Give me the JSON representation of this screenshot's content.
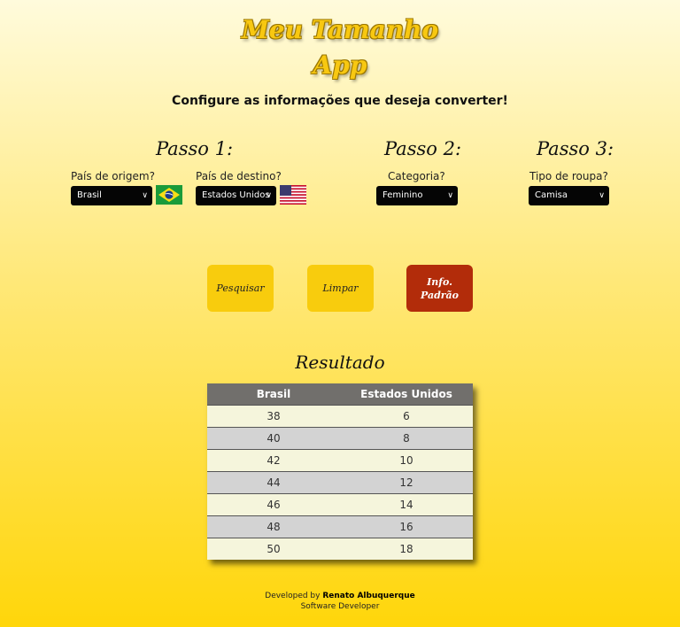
{
  "app": {
    "title_line1": "Meu Tamanho",
    "title_line2": "App",
    "subtitle": "Configure as informações que deseja converter!"
  },
  "steps": {
    "step1": "Passo 1:",
    "step2": "Passo 2:",
    "step3": "Passo 3:"
  },
  "fields": {
    "origin_label": "País de origem?",
    "origin_value": "Brasil",
    "dest_label": "País de destino?",
    "dest_value": "Estados Unidos",
    "category_label": "Categoria?",
    "category_value": "Feminino",
    "clothing_label": "Tipo de roupa?",
    "clothing_value": "Camisa"
  },
  "buttons": {
    "search": "Pesquisar",
    "clear": "Limpar",
    "info": "Info. Padrão"
  },
  "result": {
    "title": "Resultado",
    "headers": [
      "Brasil",
      "Estados Unidos"
    ],
    "rows": [
      [
        "38",
        "6"
      ],
      [
        "40",
        "8"
      ],
      [
        "42",
        "10"
      ],
      [
        "44",
        "12"
      ],
      [
        "46",
        "14"
      ],
      [
        "48",
        "16"
      ],
      [
        "50",
        "18"
      ]
    ]
  },
  "footer": {
    "prefix": "Developed by ",
    "author": "Renato Albuquerque",
    "role": "Software Developer"
  },
  "colors": {
    "accent": "#f8cc0d",
    "danger": "#b22c0a",
    "table_header": "#716f6c"
  }
}
